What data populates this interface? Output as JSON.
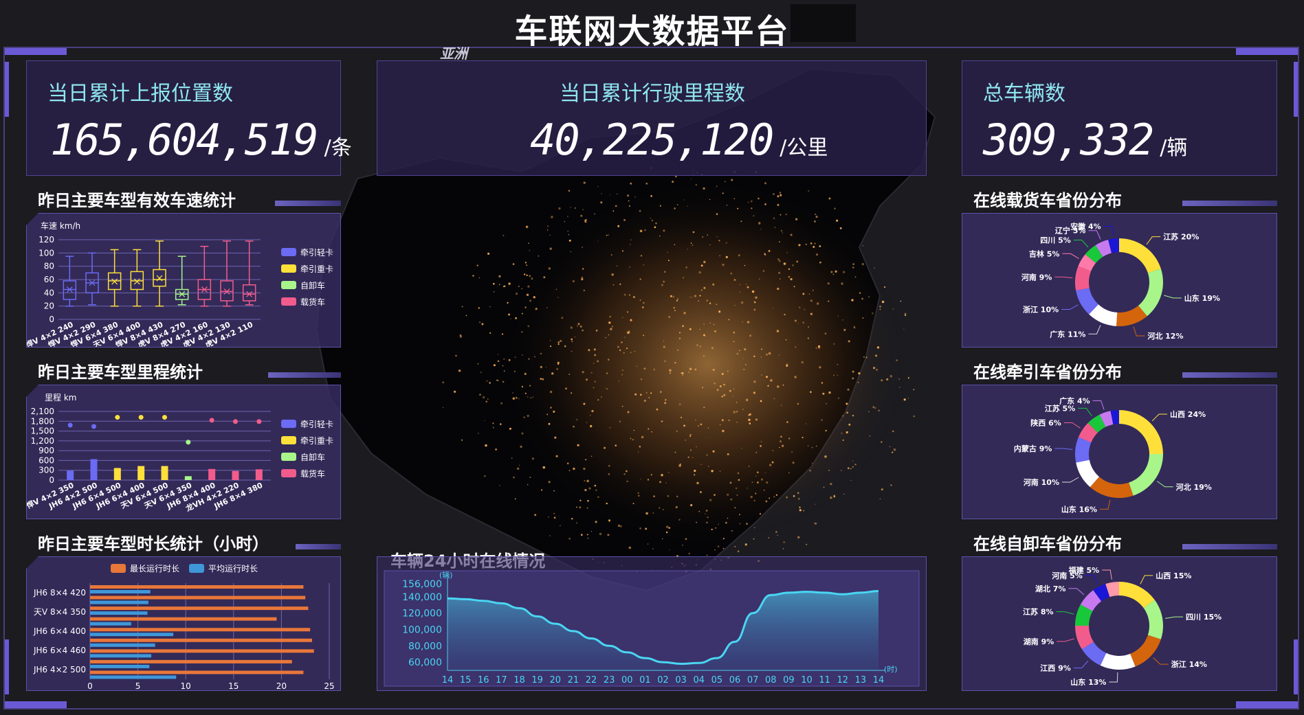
{
  "header": {
    "title": "车联网大数据平台",
    "map_label": "亚洲"
  },
  "stats": [
    {
      "label": "当日累计上报位置数",
      "value": "165,604,519",
      "unit": "/条"
    },
    {
      "label": "当日累计行驶里程数",
      "value": "40,225,120",
      "unit": "/公里"
    },
    {
      "label": "总车辆数",
      "value": "309,332",
      "unit": "/辆"
    }
  ],
  "colors": {
    "traction_light": "#6b6bf4",
    "traction_heavy": "#ffe03a",
    "dump": "#a8f58a",
    "cargo": "#f25c8c",
    "orange_bar": "#e8773a",
    "blue_bar": "#3f97d8",
    "line": "#4ad6f2",
    "accent": "#8fe6f0"
  },
  "legend": [
    "牵引轻卡",
    "牵引重卡",
    "自卸车",
    "载货车"
  ],
  "speed_chart": {
    "title": "昨日主要车型有效车速统计",
    "chart_data": {
      "type": "box",
      "ylabel": "车速 km/h",
      "ylim": [
        0,
        120
      ],
      "yticks": [
        "0",
        "20",
        "40",
        "60",
        "80",
        "100",
        "120"
      ],
      "categories": [
        "悍V 4×2 240",
        "悍V 4×2 290",
        "悍V 6×4 380",
        "天V 6×4 400",
        "悍V 8×4 430",
        "虎V 8×4 270",
        "虎V 4×2 160",
        "虎V 4×2 130",
        "虎V 4×2 110"
      ],
      "groups": [
        0,
        0,
        1,
        1,
        1,
        2,
        3,
        3,
        3
      ],
      "boxes": [
        {
          "min": 20,
          "q1": 30,
          "median": 45,
          "q3": 58,
          "max": 95,
          "mean": 45
        },
        {
          "min": 22,
          "q1": 40,
          "median": 55,
          "q3": 70,
          "max": 100,
          "mean": 55
        },
        {
          "min": 20,
          "q1": 45,
          "median": 58,
          "q3": 70,
          "max": 105,
          "mean": 57
        },
        {
          "min": 20,
          "q1": 45,
          "median": 58,
          "q3": 72,
          "max": 105,
          "mean": 57
        },
        {
          "min": 20,
          "q1": 50,
          "median": 60,
          "q3": 75,
          "max": 118,
          "mean": 62
        },
        {
          "min": 22,
          "q1": 30,
          "median": 38,
          "q3": 45,
          "max": 95,
          "mean": 38
        },
        {
          "min": 20,
          "q1": 30,
          "median": 45,
          "q3": 60,
          "max": 110,
          "mean": 45
        },
        {
          "min": 20,
          "q1": 28,
          "median": 42,
          "q3": 58,
          "max": 118,
          "mean": 42
        },
        {
          "min": 22,
          "q1": 28,
          "median": 38,
          "q3": 52,
          "max": 118,
          "mean": 38
        }
      ]
    }
  },
  "mileage_chart": {
    "title": "昨日主要车型里程统计",
    "chart_data": {
      "type": "bar",
      "ylabel": "里程 km",
      "ylim": [
        0,
        2100
      ],
      "yticks": [
        "0",
        "300",
        "600",
        "900",
        "1,200",
        "1,500",
        "1,800",
        "2,100"
      ],
      "categories": [
        "悍V 4×2 350",
        "JH6 4×2 500",
        "JH6 6×4 500",
        "JH6 6×4 400",
        "天V 6×4 500",
        "天V 6×4 350",
        "JH6 8×4 400",
        "龙VH 4×2 220",
        "JH6 8×4 380"
      ],
      "groups": [
        0,
        0,
        1,
        1,
        1,
        2,
        3,
        3,
        3
      ],
      "values": [
        290,
        640,
        370,
        430,
        430,
        120,
        340,
        280,
        330
      ],
      "points": [
        1680,
        1640,
        1920,
        1920,
        1920,
        1160,
        1830,
        1790,
        1790
      ]
    }
  },
  "duration_chart": {
    "title": "昨日主要车型时长统计（小时）",
    "chart_data": {
      "type": "bar",
      "orientation": "horizontal",
      "legend": [
        "最长运行时长",
        "平均运行时长"
      ],
      "xlim": [
        0,
        25
      ],
      "xticks": [
        "0",
        "5",
        "10",
        "15",
        "20",
        "25"
      ],
      "categories": [
        "JH6 8×4 420",
        "天V 8×4 350",
        "JH6 6×4 400",
        "JH6 6×4 460",
        "JH6 4×2 500"
      ],
      "rows": [
        {
          "max": 22.3,
          "avg": 6.3
        },
        {
          "max": 22.5,
          "avg": 6.1
        },
        {
          "max": 22.8,
          "avg": 6.0
        },
        {
          "max": 19.5,
          "avg": 4.3
        },
        {
          "max": 23.0,
          "avg": 8.7
        },
        {
          "max": 23.2,
          "avg": 6.8
        },
        {
          "max": 23.4,
          "avg": 6.4
        },
        {
          "max": 21.1,
          "avg": 6.2
        },
        {
          "max": 22.3,
          "avg": 9.0
        }
      ]
    }
  },
  "online_chart": {
    "title": "车辆24小时在线情况",
    "chart_data": {
      "type": "area",
      "yunit": "(辆)",
      "xunit": "(时)",
      "ylim": [
        50000,
        160000
      ],
      "yticks": [
        "60,000",
        "80,000",
        "100,000",
        "120,000",
        "140,000",
        "156,000"
      ],
      "x": [
        "14",
        "15",
        "16",
        "17",
        "18",
        "19",
        "20",
        "21",
        "22",
        "23",
        "00",
        "01",
        "02",
        "03",
        "04",
        "05",
        "06",
        "07",
        "08",
        "09",
        "10",
        "11",
        "12",
        "13",
        "14"
      ],
      "values": [
        138000,
        137000,
        135000,
        132000,
        126000,
        116000,
        107000,
        98000,
        89000,
        80000,
        72000,
        65000,
        60000,
        58000,
        59000,
        65000,
        85000,
        120000,
        142000,
        145000,
        146000,
        145000,
        143000,
        145000,
        147000
      ]
    }
  },
  "donuts": [
    {
      "title": "在线载货车省份分布",
      "slices": [
        {
          "label": "江苏 20%",
          "value": 20,
          "color": "#ffe03a"
        },
        {
          "label": "山东 19%",
          "value": 19,
          "color": "#a8f58a"
        },
        {
          "label": "河北 12%",
          "value": 12,
          "color": "#d4650c"
        },
        {
          "label": "广东 11%",
          "value": 11,
          "color": "#ffffff"
        },
        {
          "label": "浙江 10%",
          "value": 10,
          "color": "#6b6bf4"
        },
        {
          "label": "河南 9%",
          "value": 9,
          "color": "#f25c8c"
        },
        {
          "label": "吉林 5%",
          "value": 5,
          "color": "#ff7aa8"
        },
        {
          "label": "四川 5%",
          "value": 5,
          "color": "#19c83a"
        },
        {
          "label": "辽宁 5%",
          "value": 5,
          "color": "#c77af0"
        },
        {
          "label": "安徽 4%",
          "value": 4,
          "color": "#1a16d6"
        }
      ]
    },
    {
      "title": "在线牵引车省份分布",
      "slices": [
        {
          "label": "山西 24%",
          "value": 24,
          "color": "#ffe03a"
        },
        {
          "label": "河北 19%",
          "value": 19,
          "color": "#a8f58a"
        },
        {
          "label": "山东 16%",
          "value": 16,
          "color": "#d4650c"
        },
        {
          "label": "河南 10%",
          "value": 10,
          "color": "#ffffff"
        },
        {
          "label": "内蒙古 9%",
          "value": 9,
          "color": "#6b6bf4"
        },
        {
          "label": "陕西 6%",
          "value": 6,
          "color": "#f25c8c"
        },
        {
          "label": "江苏 5%",
          "value": 5,
          "color": "#19c83a"
        },
        {
          "label": "广东 4%",
          "value": 4,
          "color": "#c77af0"
        },
        {
          "label": "",
          "value": 3,
          "color": "#1a16d6"
        }
      ]
    },
    {
      "title": "在线自卸车省份分布",
      "slices": [
        {
          "label": "山西 15%",
          "value": 15,
          "color": "#ffe03a"
        },
        {
          "label": "四川 15%",
          "value": 15,
          "color": "#a8f58a"
        },
        {
          "label": "浙江 14%",
          "value": 14,
          "color": "#d4650c"
        },
        {
          "label": "山东 13%",
          "value": 13,
          "color": "#ffffff"
        },
        {
          "label": "江西 9%",
          "value": 9,
          "color": "#6b6bf4"
        },
        {
          "label": "湖南 9%",
          "value": 9,
          "color": "#f25c8c"
        },
        {
          "label": "江苏 8%",
          "value": 8,
          "color": "#19c83a"
        },
        {
          "label": "湖北 7%",
          "value": 7,
          "color": "#c77af0"
        },
        {
          "label": "河南 5%",
          "value": 5,
          "color": "#1a16d6"
        },
        {
          "label": "福建 5%",
          "value": 5,
          "color": "#ff9aa8"
        }
      ]
    }
  ]
}
